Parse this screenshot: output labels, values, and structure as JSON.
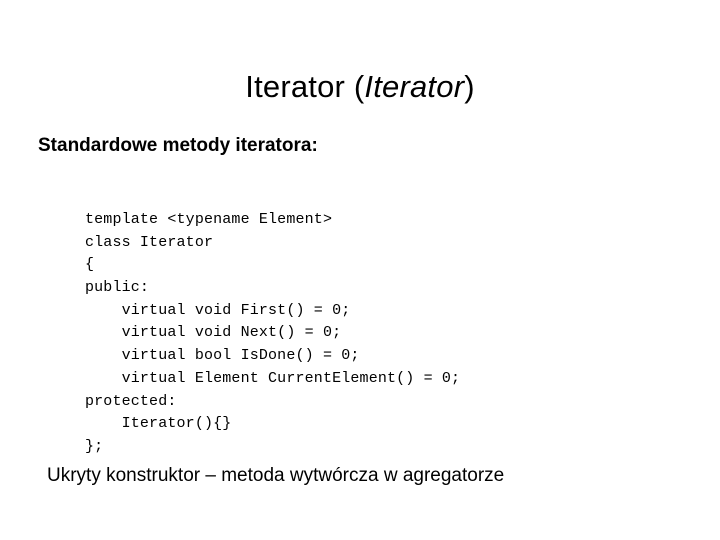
{
  "slide": {
    "title": {
      "main": "Iterator",
      "open_paren": " (",
      "italic_part": "Iterator",
      "close_paren": ")"
    },
    "subheading": "Standardowe metody iteratora:",
    "code": {
      "language": "cpp",
      "lines": [
        "template <typename Element>",
        "class Iterator",
        "{",
        "public:",
        "    virtual void First() = 0;",
        "    virtual void Next() = 0;",
        "    virtual bool IsDone() = 0;",
        "    virtual Element CurrentElement() = 0;",
        "protected:",
        "    Iterator(){}",
        "};"
      ]
    },
    "caption": "Ukryty konstruktor – metoda wytwórcza w agregatorze"
  },
  "colors": {
    "background": "#ffffff",
    "text": "#000000"
  }
}
